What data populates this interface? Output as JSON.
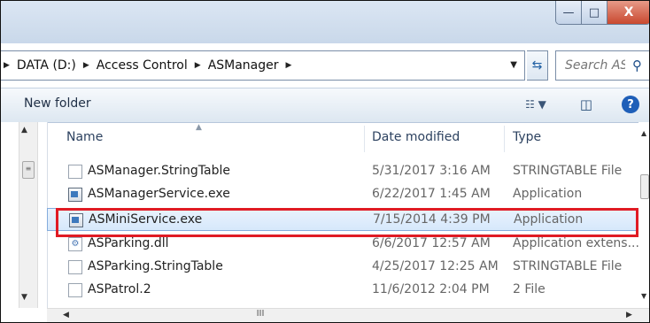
{
  "window": {
    "minimize_glyph": "—",
    "maximize_glyph": "□",
    "close_glyph": "X"
  },
  "address": {
    "crumbs": [
      "DATA (D:)",
      "Access Control",
      "ASManager"
    ],
    "search_placeholder": "Search AS..."
  },
  "toolbar": {
    "new_folder_label": "New folder"
  },
  "columns": {
    "name": "Name",
    "date_modified": "Date modified",
    "type": "Type"
  },
  "files": [
    {
      "name": "ASManager.StringTable",
      "date": "5/31/2017 3:16 AM",
      "type": "STRINGTABLE File",
      "icon": "file-icon"
    },
    {
      "name": "ASManagerService.exe",
      "date": "6/22/2017 1:45 AM",
      "type": "Application",
      "icon": "exe-icon"
    },
    {
      "name": "ASMiniService.exe",
      "date": "7/15/2014 4:39 PM",
      "type": "Application",
      "icon": "exe-icon",
      "selected": true
    },
    {
      "name": "ASParking.dll",
      "date": "6/6/2017 12:57 AM",
      "type": "Application extens...",
      "icon": "dll-icon"
    },
    {
      "name": "ASParking.StringTable",
      "date": "4/25/2017 12:25 AM",
      "type": "STRINGTABLE File",
      "icon": "file-icon"
    },
    {
      "name": "ASPatrol.2",
      "date": "11/6/2012 2:04 PM",
      "type": "2 File",
      "icon": "file-icon"
    }
  ],
  "colors": {
    "highlight_border": "#e01b24",
    "selection_bg": "#d6e8fb",
    "title_bar": "#c9d8ea"
  }
}
